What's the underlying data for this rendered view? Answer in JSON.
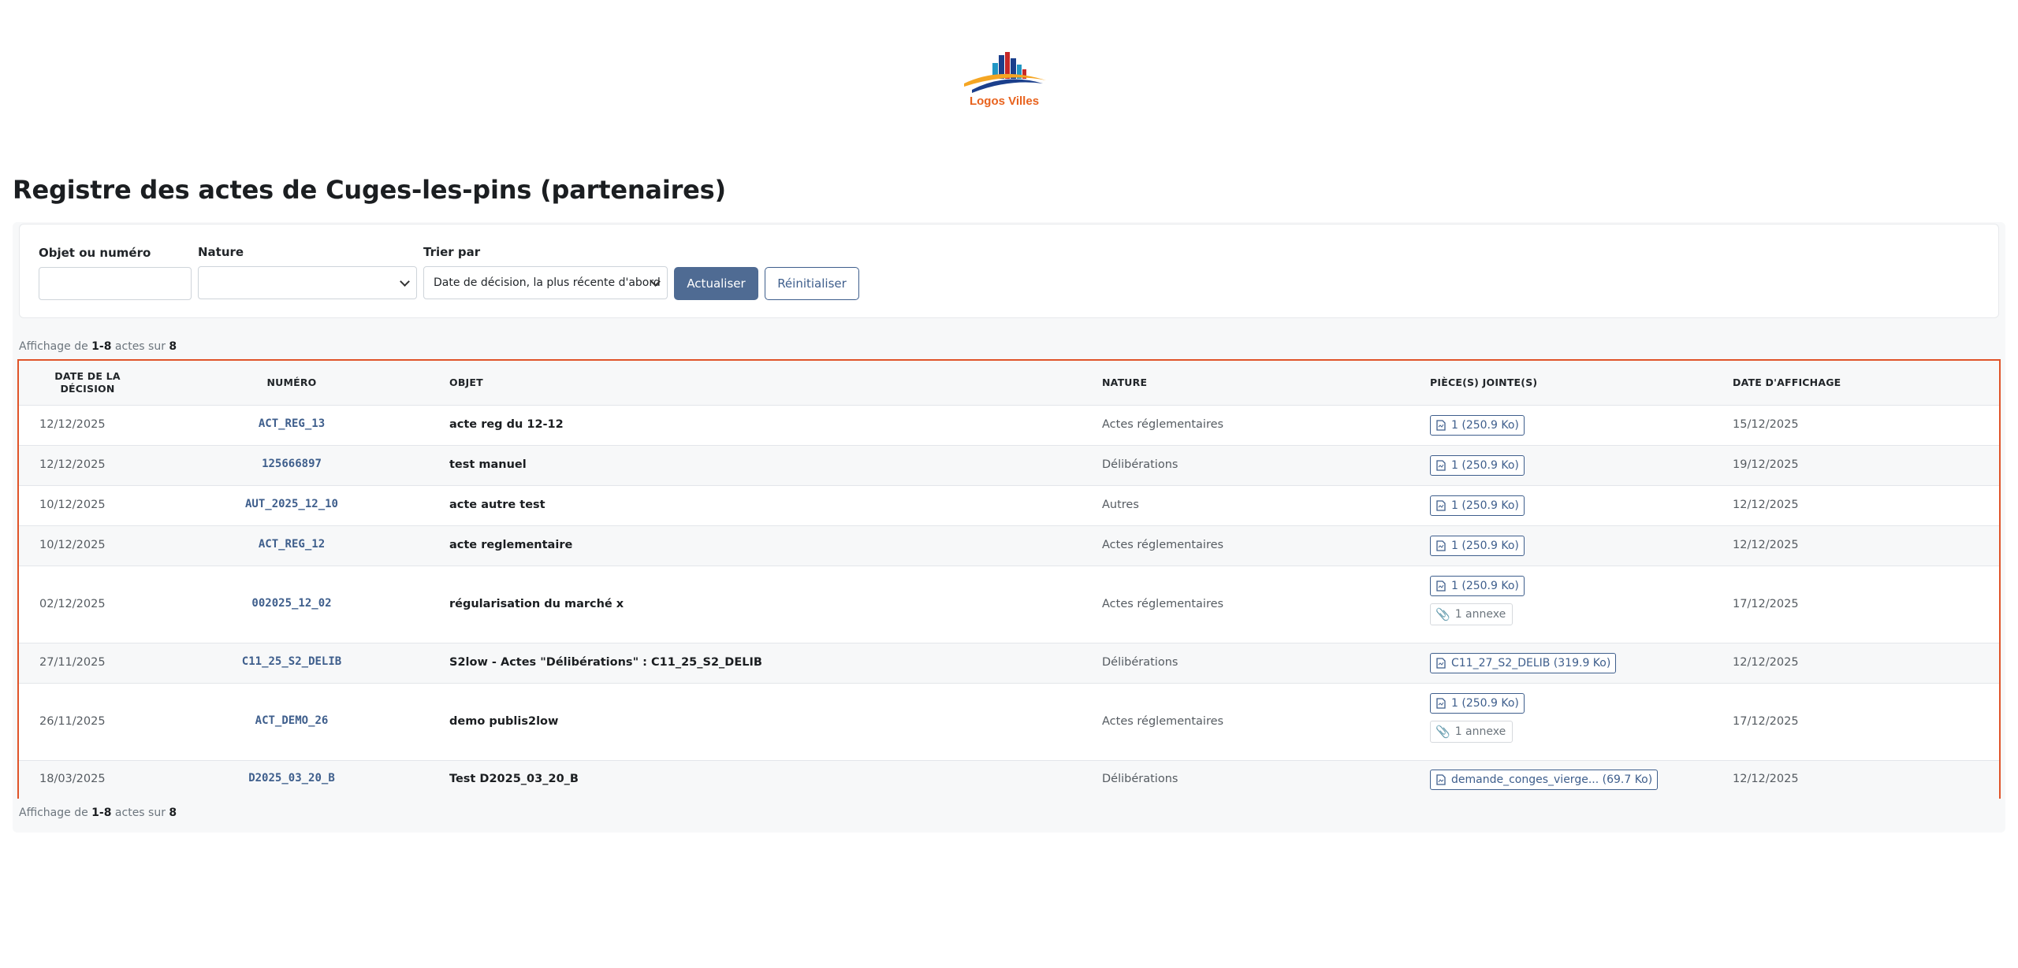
{
  "logo": {
    "text": "Logos Villes"
  },
  "page_title": "Registre des actes de Cuges-les-pins (partenaires)",
  "filters": {
    "objet_label": "Objet ou numéro",
    "objet_value": "",
    "nature_label": "Nature",
    "nature_value": "",
    "tri_label": "Trier par",
    "tri_value": "Date de décision, la plus récente d'abord",
    "update_button": "Actualiser",
    "reset_button": "Réinitialiser"
  },
  "count": {
    "prefix": "Affichage de",
    "range": "1-8",
    "middle": "actes sur",
    "total": "8"
  },
  "table": {
    "headers": {
      "date_line1": "DATE DE LA",
      "date_line2": "DÉCISION",
      "numero": "NUMÉRO",
      "objet": "OBJET",
      "nature": "NATURE",
      "pieces": "PIÈCE(S) JOINTE(S)",
      "affichage": "DATE D'AFFICHAGE"
    },
    "rows": [
      {
        "date": "12/12/2025",
        "numero": "ACT_REG_13",
        "objet": "acte reg du 12-12",
        "nature": "Actes réglementaires",
        "piece": "1 (250.9 Ko)",
        "annexe": "",
        "affichage": "15/12/2025"
      },
      {
        "date": "12/12/2025",
        "numero": "125666897",
        "objet": "test manuel",
        "nature": "Délibérations",
        "piece": "1 (250.9 Ko)",
        "annexe": "",
        "affichage": "19/12/2025"
      },
      {
        "date": "10/12/2025",
        "numero": "AUT_2025_12_10",
        "objet": "acte autre test",
        "nature": "Autres",
        "piece": "1 (250.9 Ko)",
        "annexe": "",
        "affichage": "12/12/2025"
      },
      {
        "date": "10/12/2025",
        "numero": "ACT_REG_12",
        "objet": "acte reglementaire",
        "nature": "Actes réglementaires",
        "piece": "1 (250.9 Ko)",
        "annexe": "",
        "affichage": "12/12/2025"
      },
      {
        "date": "02/12/2025",
        "numero": "002025_12_02",
        "objet": "régularisation du marché x",
        "nature": "Actes réglementaires",
        "piece": "1 (250.9 Ko)",
        "annexe": "1 annexe",
        "affichage": "17/12/2025"
      },
      {
        "date": "27/11/2025",
        "numero": "C11_25_S2_DELIB",
        "objet": "S2low - Actes \"Délibérations\" : C11_25_S2_DELIB",
        "nature": "Délibérations",
        "piece": "C11_27_S2_DELIB (319.9 Ko)",
        "annexe": "",
        "affichage": "12/12/2025"
      },
      {
        "date": "26/11/2025",
        "numero": "ACT_DEMO_26",
        "objet": "demo publis2low",
        "nature": "Actes réglementaires",
        "piece": "1 (250.9 Ko)",
        "annexe": "1 annexe",
        "affichage": "17/12/2025"
      },
      {
        "date": "18/03/2025",
        "numero": "D2025_03_20_B",
        "objet": "Test D2025_03_20_B",
        "nature": "Délibérations",
        "piece": "demande_conges_vierge... (69.7 Ko)",
        "annexe": "",
        "affichage": "12/12/2025"
      }
    ]
  },
  "colors": {
    "accent": "#4f6b93",
    "highlight_border": "#e0542a",
    "link": "#3e5e8c"
  }
}
